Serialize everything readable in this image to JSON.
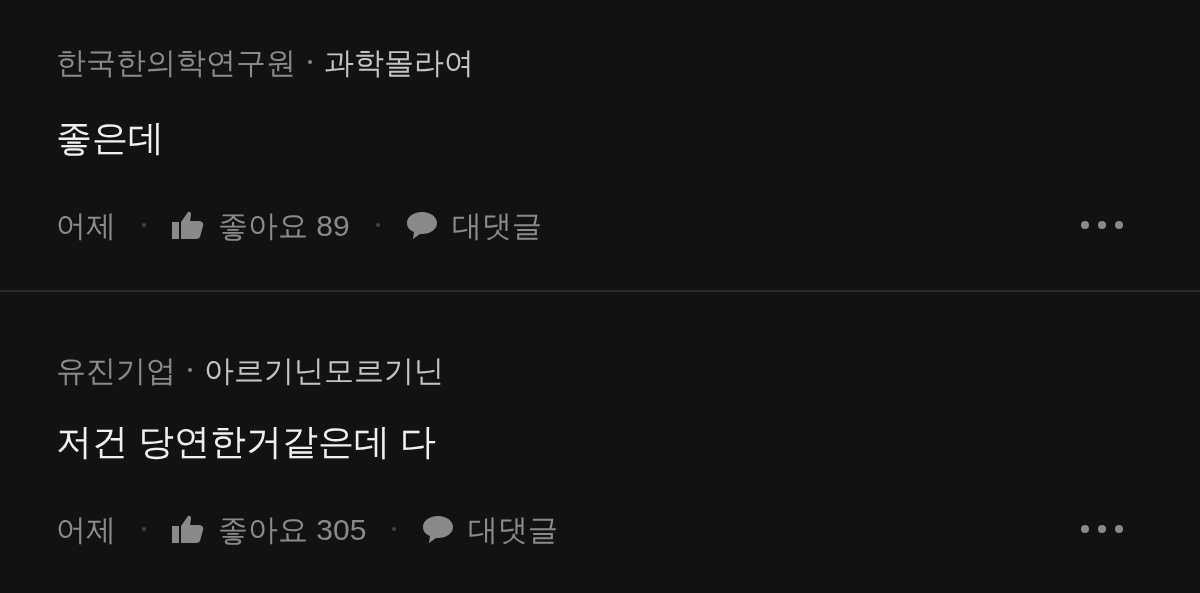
{
  "comments": [
    {
      "organization": "한국한의학연구원",
      "nickname": "과학몰라여",
      "text": "좋은데",
      "time": "어제",
      "likes": "좋아요 89",
      "reply": "대댓글"
    },
    {
      "organization": "유진기업",
      "nickname": "아르기닌모르기닌",
      "text": "저건 당연한거같은데 다",
      "time": "어제",
      "likes": "좋아요 305",
      "reply": "대댓글"
    }
  ]
}
